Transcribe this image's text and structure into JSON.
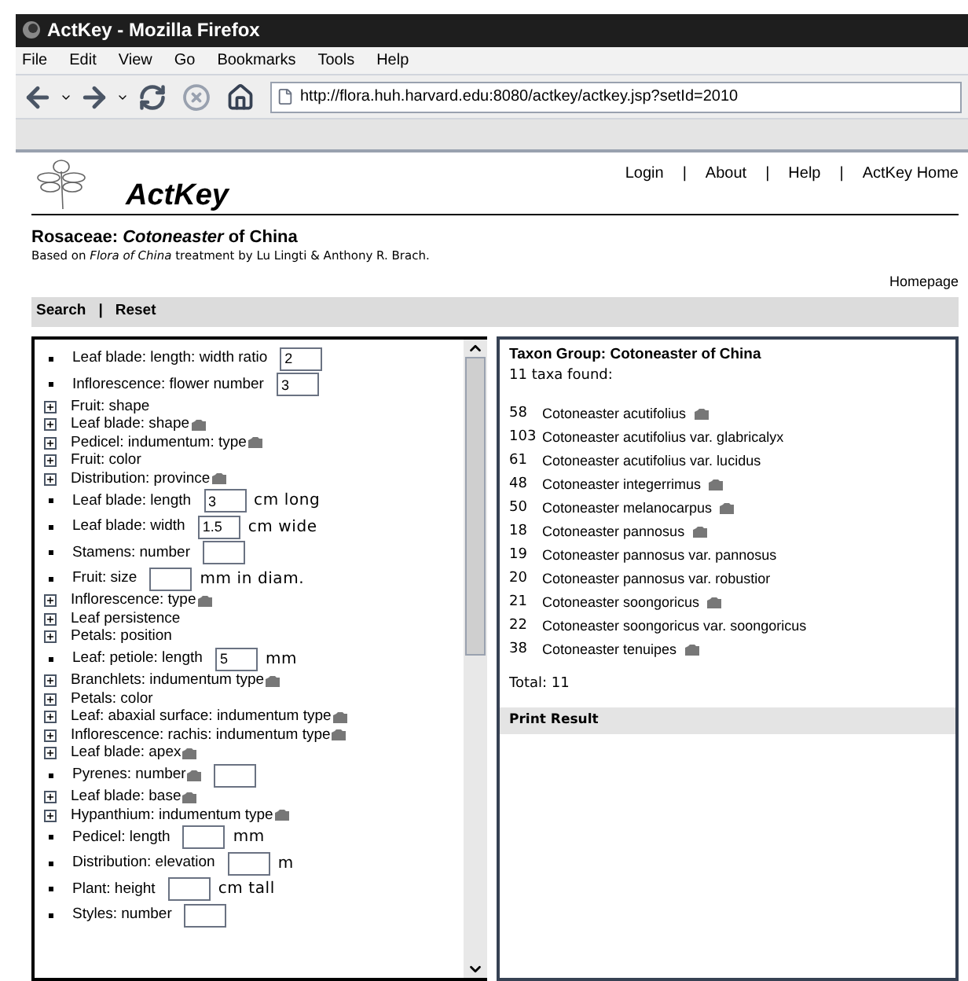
{
  "window": {
    "title": "ActKey - Mozilla Firefox"
  },
  "menu": [
    "File",
    "Edit",
    "View",
    "Go",
    "Bookmarks",
    "Tools",
    "Help"
  ],
  "address": "http://flora.huh.harvard.edu:8080/actkey/actkey.jsp?setId=2010",
  "site": {
    "logo_text": "ActKey",
    "nav": [
      "Login",
      "About",
      "Help",
      "ActKey Home"
    ],
    "separator": "|"
  },
  "heading": "Rosaceae: *Cotoneaster* of China",
  "subheading": "Based on *Flora of China* treatment by Lu Lingti & Anthony R. Brach.",
  "homepage_link": "Homepage",
  "actions": [
    "Search",
    "Reset"
  ],
  "characters": [
    {
      "kind": "numeric",
      "label": "Leaf blade: length: width ratio",
      "value": "2",
      "has_image": false
    },
    {
      "kind": "numeric",
      "label": "Inflorescence: flower number",
      "value": "3",
      "has_image": false
    },
    {
      "kind": "group",
      "label": "Fruit: shape",
      "has_image": false
    },
    {
      "kind": "group",
      "label": "Leaf blade: shape",
      "has_image": true
    },
    {
      "kind": "group",
      "label": "Pedicel: indumentum: type",
      "has_image": true
    },
    {
      "kind": "group",
      "label": "Fruit: color",
      "has_image": false
    },
    {
      "kind": "group",
      "label": "Distribution: province",
      "has_image": true
    },
    {
      "kind": "numeric",
      "label": "Leaf blade: length",
      "value": "3",
      "unit": "cm long",
      "has_image": false
    },
    {
      "kind": "numeric",
      "label": "Leaf blade: width",
      "value": "1.5",
      "unit": "cm wide",
      "has_image": false
    },
    {
      "kind": "numeric",
      "label": "Stamens: number",
      "has_image": false
    },
    {
      "kind": "numeric",
      "label": "Fruit: size",
      "unit": "mm in diam.",
      "has_image": false
    },
    {
      "kind": "group",
      "label": "Inflorescence: type",
      "has_image": true
    },
    {
      "kind": "group",
      "label": "Leaf persistence",
      "has_image": false
    },
    {
      "kind": "group",
      "label": "Petals: position",
      "has_image": false
    },
    {
      "kind": "numeric",
      "label": "Leaf: petiole: length",
      "value": "5",
      "unit": "mm",
      "has_image": false
    },
    {
      "kind": "group",
      "label": "Branchlets: indumentum type",
      "has_image": true
    },
    {
      "kind": "group",
      "label": "Petals: color",
      "has_image": false
    },
    {
      "kind": "group",
      "label": "Leaf: abaxial surface: indumentum type",
      "has_image": true
    },
    {
      "kind": "group",
      "label": "Inflorescence: rachis: indumentum type",
      "has_image": true
    },
    {
      "kind": "group",
      "label": "Leaf blade: apex",
      "has_image": true
    },
    {
      "kind": "numeric",
      "label": "Pyrenes: number",
      "has_image": true
    },
    {
      "kind": "group",
      "label": "Leaf blade: base",
      "has_image": true
    },
    {
      "kind": "group",
      "label": "Hypanthium: indumentum type",
      "has_image": true
    },
    {
      "kind": "numeric",
      "label": "Pedicel: length",
      "unit": "mm",
      "has_image": false
    },
    {
      "kind": "numeric",
      "label": "Distribution: elevation",
      "unit": "m",
      "has_image": false
    },
    {
      "kind": "numeric",
      "label": "Plant: height",
      "unit": "cm tall",
      "has_image": false
    },
    {
      "kind": "numeric",
      "label": "Styles: number",
      "has_image": false
    }
  ],
  "results": {
    "title": "Taxon Group: Cotoneaster of China",
    "count_text": "11 taxa found:",
    "taxa": [
      {
        "number": "58",
        "name": "Cotoneaster acutifolius",
        "has_image": true
      },
      {
        "number": "103",
        "name": "Cotoneaster acutifolius var. glabricalyx",
        "has_image": false
      },
      {
        "number": "61",
        "name": "Cotoneaster acutifolius var. lucidus",
        "has_image": false
      },
      {
        "number": "48",
        "name": "Cotoneaster integerrimus",
        "has_image": true
      },
      {
        "number": "50",
        "name": "Cotoneaster melanocarpus",
        "has_image": true
      },
      {
        "number": "18",
        "name": "Cotoneaster pannosus",
        "has_image": true
      },
      {
        "number": "19",
        "name": "Cotoneaster pannosus var. pannosus",
        "has_image": false
      },
      {
        "number": "20",
        "name": "Cotoneaster pannosus var. robustior",
        "has_image": false
      },
      {
        "number": "21",
        "name": "Cotoneaster soongoricus",
        "has_image": true
      },
      {
        "number": "22",
        "name": "Cotoneaster soongoricus var. soongoricus",
        "has_image": false
      },
      {
        "number": "38",
        "name": "Cotoneaster tenuipes",
        "has_image": true
      }
    ],
    "total": "Total: 11",
    "print": "Print Result"
  }
}
